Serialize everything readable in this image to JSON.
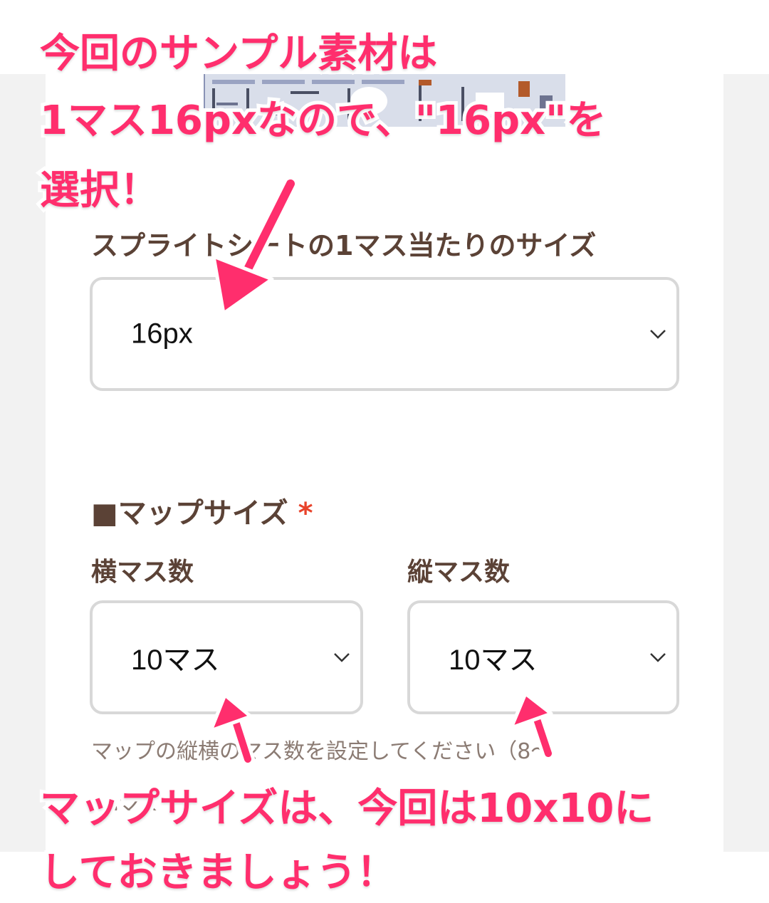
{
  "sprite_size": {
    "label": "スプライトシートの1マス当たりのサイズ",
    "selected": "16px"
  },
  "map_size": {
    "heading": "■マップサイズ",
    "required_mark": "*",
    "width": {
      "label": "横マス数",
      "selected": "10マス"
    },
    "height": {
      "label": "縦マス数",
      "selected": "10マス"
    },
    "help_text": "マップの縦横のマス数を設定してください（8〜",
    "help_text_cont": "16マス"
  },
  "annotations": {
    "top_line1": "今回のサンプル素材は",
    "top_line2": "1マス16pxなので、\"16px\"を",
    "top_line3": "選択！",
    "bottom_line1": "マップサイズは、今回は10x10に",
    "bottom_line2": "しておきましょう！"
  },
  "colors": {
    "annotation": "#ff2e6d",
    "label_text": "#5b4236",
    "required": "#e8432b",
    "select_border": "#d8d8d8"
  }
}
